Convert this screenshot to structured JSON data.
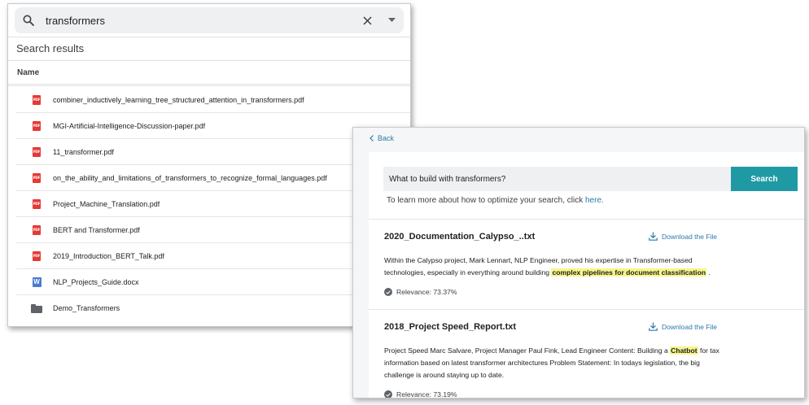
{
  "drive": {
    "search": {
      "query": "transformers",
      "search_icon": "search-icon",
      "clear_icon": "close-icon",
      "dropdown_icon": "chevron-down-icon"
    },
    "results_heading": "Search results",
    "column_header": "Name",
    "files": [
      {
        "name": "combiner_inductively_learning_tree_structured_attention_in_transformers.pdf",
        "type": "pdf"
      },
      {
        "name": "MGI-Artificial-Intelligence-Discussion-paper.pdf",
        "type": "pdf"
      },
      {
        "name": "11_transformer.pdf",
        "type": "pdf"
      },
      {
        "name": "on_the_ability_and_limitations_of_transformers_to_recognize_formal_languages.pdf",
        "type": "pdf"
      },
      {
        "name": "Project_Machine_Translation.pdf",
        "type": "pdf"
      },
      {
        "name": "BERT and Transformer.pdf",
        "type": "pdf"
      },
      {
        "name": "2019_Introduction_BERT_Talk.pdf",
        "type": "pdf"
      },
      {
        "name": "NLP_Projects_Guide.docx",
        "type": "docx"
      },
      {
        "name": "Demo_Transformers",
        "type": "folder"
      }
    ],
    "icons": {
      "pdf_label": "PDF",
      "docx_label": "W"
    },
    "colors": {
      "pdf": "#e53935",
      "docx": "#4a7bd0",
      "folder": "#5f6368"
    }
  },
  "ai_search": {
    "back_label": "Back",
    "query": "What to build with transformers?",
    "search_button": "Search",
    "hint_text": "To learn more about how to optimize your search, click ",
    "hint_link": "here.",
    "download_label": "Download the File",
    "results": [
      {
        "title": "2020_Documentation_Calypso_..txt",
        "text_before": "Within the Calypso project, Mark Lennart, NLP Engineer, proved his expertise in Transformer-based technologies, especially in everything around building ",
        "highlight": "complex pipelines for document classification",
        "text_after": " .",
        "relevance": "Relevance: 73.37%"
      },
      {
        "title": "2018_Project Speed_Report.txt",
        "text_before": "Project Speed Marc Salvare, Project Manager Paul Fink, Lead Engineer Content: Building a ",
        "highlight": "Chatbot",
        "text_after": " for tax information based on latest transformer architectures Problem Statement: In todays legislation, the big challenge is around staying up to date.",
        "relevance": "Relevance: 73.19%"
      }
    ],
    "colors": {
      "accent": "#1f9aa5",
      "link": "#2a7aa8",
      "highlight": "#f7f58a"
    }
  }
}
